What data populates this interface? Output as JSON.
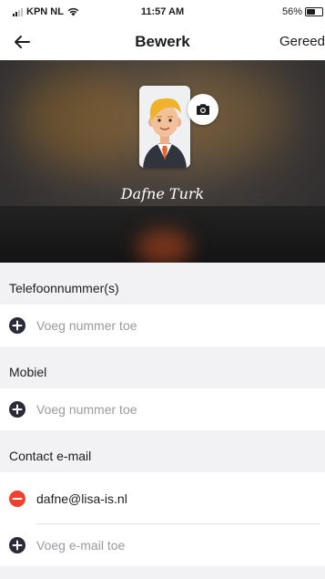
{
  "status_bar": {
    "carrier": "KPN NL",
    "time": "11:57 AM",
    "battery": "56%",
    "battery_level": 0.56
  },
  "nav": {
    "title": "Bewerk",
    "done_label": "Gereed",
    "back_icon": "arrow-left-icon"
  },
  "profile": {
    "name": "Dafne Turk",
    "camera_icon": "camera-icon"
  },
  "sections": {
    "phone": {
      "header": "Telefoonnummer(s)",
      "add_label": "Voeg nummer toe"
    },
    "mobile": {
      "header": "Mobiel",
      "add_label": "Voeg nummer toe"
    },
    "email": {
      "header": "Contact e-mail",
      "value": "dafne@lisa-is.nl",
      "add_label": "Voeg e-mail toe"
    }
  },
  "colors": {
    "add": "#2a2a3a",
    "remove": "#f0402e"
  }
}
